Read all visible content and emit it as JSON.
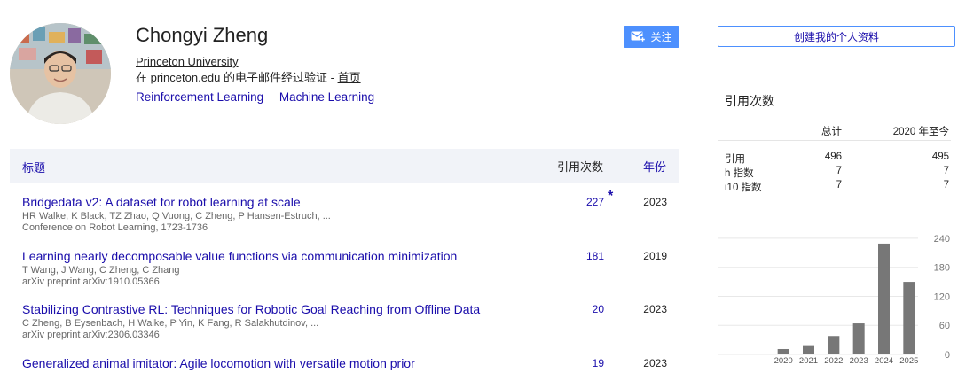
{
  "profile": {
    "name": "Chongyi Zheng",
    "affiliation": "Princeton University",
    "verified_text": "在 princeton.edu 的电子邮件经过验证 - ",
    "homepage_label": "首页",
    "interests": [
      "Reinforcement Learning",
      "Machine Learning"
    ],
    "follow_label": "关注"
  },
  "table": {
    "col_title": "标题",
    "col_cites": "引用次数",
    "col_year": "年份",
    "rows": [
      {
        "title": "Bridgedata v2: A dataset for robot learning at scale",
        "authors": "HR Walke, K Black, TZ Zhao, Q Vuong, C Zheng, P Hansen-Estruch, ...",
        "venue": "Conference on Robot Learning, 1723-1736",
        "cites": "227",
        "star": "*",
        "year": "2023"
      },
      {
        "title": "Learning nearly decomposable value functions via communication minimization",
        "authors": "T Wang, J Wang, C Zheng, C Zhang",
        "venue": "arXiv preprint arXiv:1910.05366",
        "cites": "181",
        "star": "",
        "year": "2019"
      },
      {
        "title": "Stabilizing Contrastive RL: Techniques for Robotic Goal Reaching from Offline Data",
        "authors": "C Zheng, B Eysenbach, H Walke, P Yin, K Fang, R Salakhutdinov, ...",
        "venue": "arXiv preprint arXiv:2306.03346",
        "cites": "20",
        "star": "",
        "year": "2023"
      },
      {
        "title": "Generalized animal imitator: Agile locomotion with versatile motion prior",
        "authors": "",
        "venue": "",
        "cites": "19",
        "star": "",
        "year": "2023"
      }
    ]
  },
  "sidebar": {
    "create_profile_label": "创建我的个人资料",
    "cited_by_heading": "引用次数",
    "stats_header": {
      "total": "总计",
      "since": "2020 年至今"
    },
    "stats": [
      {
        "label": "引用",
        "total": "496",
        "since": "495"
      },
      {
        "label": "h 指数",
        "total": "7",
        "since": "7"
      },
      {
        "label": "i10 指数",
        "total": "7",
        "since": "7"
      }
    ]
  },
  "chart_data": {
    "type": "bar",
    "categories": [
      "2020",
      "2021",
      "2022",
      "2023",
      "2024",
      "2025"
    ],
    "values": [
      11,
      19,
      38,
      64,
      229,
      150
    ],
    "yticks": [
      0,
      60,
      120,
      180,
      240
    ],
    "ylim": [
      0,
      260
    ],
    "bar_color": "#777777",
    "grid": true
  },
  "colors": {
    "link": "#1a0dab",
    "accent": "#4d90fe",
    "header_bg": "#f1f3f8"
  }
}
